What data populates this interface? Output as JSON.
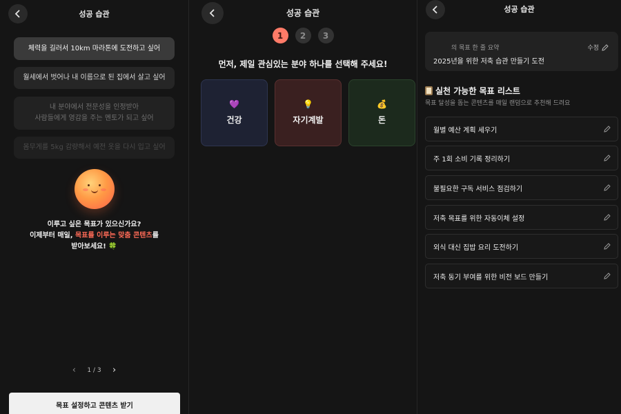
{
  "app": {
    "title": "성공 습관"
  },
  "screen1": {
    "goals": [
      "체력을 길러서 10km 마라톤에 도전하고 싶어",
      "월세에서 벗어나 내 이름으로 된 집에서 살고 싶어",
      "내 분야에서 전문성을 인정받아",
      "사람들에게 영감을 주는 멘토가 되고 싶어",
      "몸무게를 5kg 감량해서 예전 옷을 다시 입고 싶어"
    ],
    "promo_line1": "이루고 싶은 목표가 있으신가요?",
    "promo_line2_prefix": "이제부터 매일, ",
    "promo_line2_highlight": "목표를 이루는 맞춤 콘텐츠",
    "promo_line2_suffix": "를",
    "promo_line3": "받아보세요! 🍀",
    "pager": "1 / 3",
    "cta": "목표 설정하고 콘텐츠 받기"
  },
  "screen2": {
    "steps": [
      "1",
      "2",
      "3"
    ],
    "question": "먼저, 제일 관심있는 분야 하나를 선택해 주세요!",
    "categories": [
      {
        "icon": "💜",
        "label": "건강"
      },
      {
        "icon": "💡",
        "label": "자기계발"
      },
      {
        "icon": "💰",
        "label": "돈"
      }
    ]
  },
  "screen3": {
    "summary_label": "의 목표 한 줄 요약",
    "edit_label": "수정",
    "summary_value": "2025년을 위한 저축 습관 만들기 도전",
    "list_title": "실천 가능한 목표 리스트",
    "list_subtitle": "목표 달성을 돕는 콘텐츠를 매일 랜덤으로 추천해 드려요",
    "items": [
      "월별 예산 계획 세우기",
      "주 1회 소비 기록 정리하기",
      "불필요한 구독 서비스 점검하기",
      "저축 목표를 위한 자동이체 설정",
      "외식 대신 집밥 요리 도전하기",
      "저축 동기 부여를 위한 비전 보드 만들기"
    ]
  },
  "colors": {
    "accent": "#ff6b57",
    "step_active": "#ff7b68",
    "background": "#151515"
  }
}
